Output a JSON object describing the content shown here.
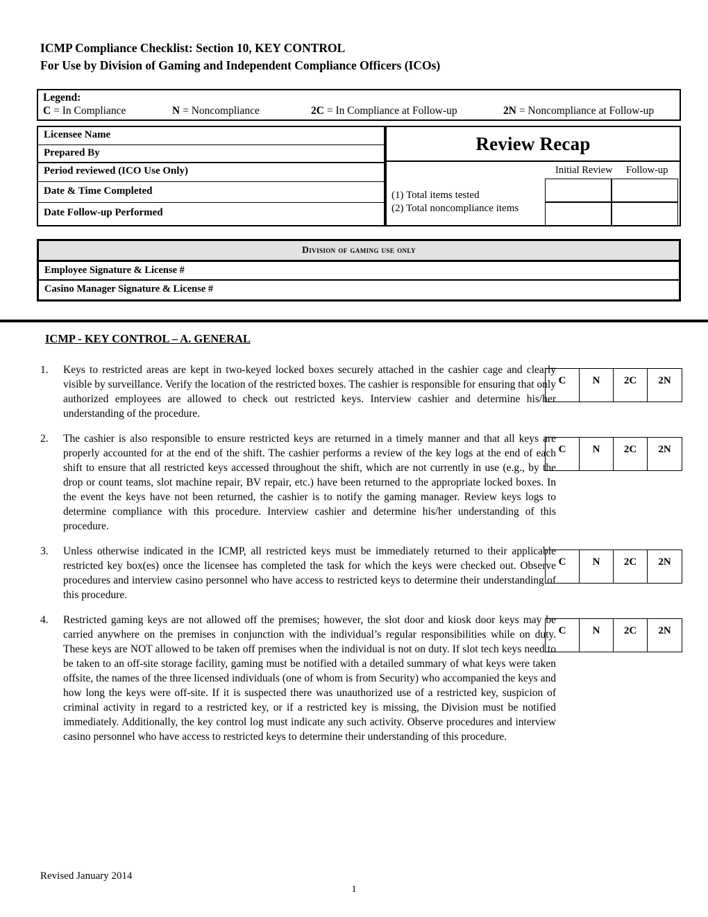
{
  "document": {
    "title_line_1": "ICMP Compliance Checklist: Section 10, KEY CONTROL",
    "title_line_2": "For Use by Division of Gaming and Independent Compliance Officers (ICOs)"
  },
  "legend": {
    "heading": "Legend:",
    "items": [
      {
        "code": "C",
        "text": " = In Compliance"
      },
      {
        "code": "N",
        "text": " = Noncompliance"
      },
      {
        "code": "2C",
        "text": " = In Compliance at Follow-up"
      },
      {
        "code": "2N",
        "text": " = Noncompliance at Follow-up"
      }
    ]
  },
  "info_table": {
    "rows": [
      "Licensee Name",
      "Prepared By",
      "Period reviewed (ICO Use Only)",
      "Date & Time Completed",
      "Date Follow-up Performed"
    ]
  },
  "review_recap": {
    "title": "Review Recap",
    "column_headers": [
      "Initial Review",
      "Follow-up"
    ],
    "metrics": [
      {
        "label": "(1) Total items tested",
        "initial_review": "",
        "follow_up": ""
      },
      {
        "label": "(2)  Total noncompliance items",
        "initial_review": "",
        "follow_up": ""
      }
    ]
  },
  "division_block": {
    "heading": "Division of gaming use only",
    "rows": [
      "Employee Signature & License #",
      "Casino Manager Signature & License #"
    ]
  },
  "section": {
    "heading": "ICMP - KEY CONTROL – A.  GENERAL"
  },
  "compliance_options": [
    "C",
    "N",
    "2C",
    "2N"
  ],
  "checklist": [
    {
      "number": "1.",
      "text": "Keys to restricted areas are kept in two-keyed locked boxes securely attached in the cashier cage and clearly visible by surveillance.  Verify the location of the restricted boxes.  The cashier is responsible for ensuring that only authorized employees are allowed to check out restricted keys.  Interview cashier and determine his/her understanding of the procedure."
    },
    {
      "number": "2.",
      "text": "The cashier is also responsible to ensure restricted keys are returned in a timely manner and that all keys are properly accounted for at the end of the shift.  The cashier performs a review of the key logs at the end of each shift to ensure that all restricted keys accessed throughout the shift, which are not currently in use (e.g., by the drop or count teams, slot machine repair, BV repair, etc.) have been returned to the appropriate locked boxes.  In the event the keys have not been returned, the cashier is to notify the gaming manager.  Review keys logs to determine compliance with this procedure.  Interview cashier and determine his/her understanding of this procedure."
    },
    {
      "number": "3.",
      "text": "Unless otherwise indicated in the ICMP, all restricted keys must be immediately returned to their applicable restricted key box(es) once the licensee has completed the task for which the keys were checked out.  Observe procedures and interview casino personnel who have access to restricted keys to determine their understanding of this procedure."
    },
    {
      "number": "4.",
      "text": "Restricted gaming keys are not allowed off the premises; however, the slot door and kiosk door keys may be carried anywhere on the premises in conjunction with the individual’s regular responsibilities while on duty. These keys are NOT allowed to be taken off premises when the individual is not on duty. If slot tech keys need to be taken to an off-site storage facility, gaming must be notified with a detailed summary of what keys were taken offsite, the names of the three licensed individuals (one of whom is from Security) who accompanied the keys and how long the keys were off-site. If it is suspected there was unauthorized use of a restricted key, suspicion of criminal activity in regard to a restricted key, or if a restricted key is missing, the Division must be notified immediately. Additionally, the key control log must indicate any such activity.   Observe procedures and interview casino personnel who have access to restricted keys to determine their understanding of this procedure."
    }
  ],
  "footer": {
    "revised": "Revised January 2014",
    "page_number": "1"
  }
}
